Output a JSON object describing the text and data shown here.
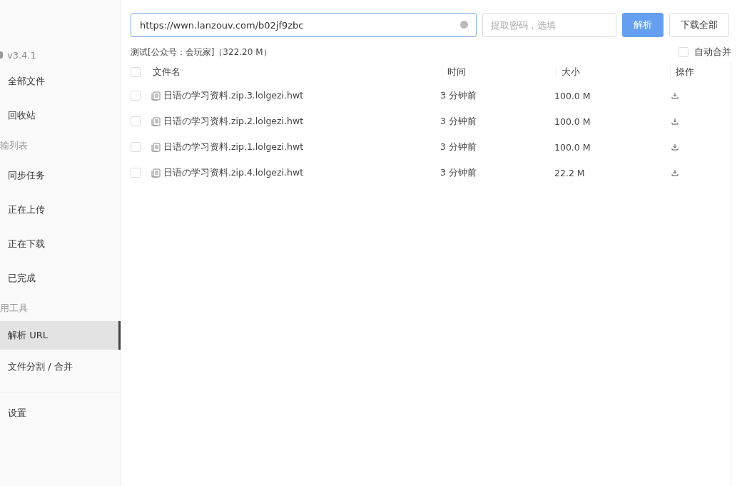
{
  "sidebar": {
    "version": "v3.4.1",
    "sections": [
      {
        "items": [
          {
            "label": "全部文件",
            "selected": false
          },
          {
            "label": "回收站",
            "selected": false
          }
        ]
      },
      {
        "title": "输列表",
        "items": [
          {
            "label": "同步任务",
            "selected": false
          },
          {
            "label": "正在上传",
            "selected": false
          },
          {
            "label": "正在下载",
            "selected": false
          },
          {
            "label": "已完成",
            "selected": false
          }
        ]
      },
      {
        "title": "用工具",
        "items": [
          {
            "label": "解析 URL",
            "selected": true
          },
          {
            "label": "文件分割 / 合并",
            "selected": false
          }
        ]
      },
      {
        "items": [
          {
            "label": "设置",
            "selected": false
          }
        ]
      }
    ]
  },
  "url_field": {
    "value": "https://wwn.lanzouv.com/b02jf9zbc"
  },
  "password_field": {
    "placeholder": "提取密码，选填"
  },
  "buttons": [
    {
      "label": "解析",
      "kind": "primary"
    },
    {
      "label": "下载全部",
      "kind": "default"
    }
  ],
  "summary": "测试[公众号：会玩家]（322.20 M）",
  "auto_merge": {
    "label": "自动合并",
    "checked": false
  },
  "table": {
    "select_all": {
      "checked": false
    },
    "columns": [
      "文件名",
      "时间",
      "大小",
      "操作"
    ],
    "rows": [
      {
        "name": "日语の学习资料.zip.3.lolgezi.hwt",
        "time": "3 分钟前",
        "size": "100.0 M",
        "checked": false
      },
      {
        "name": "日语の学习资料.zip.2.lolgezi.hwt",
        "time": "3 分钟前",
        "size": "100.0 M",
        "checked": false
      },
      {
        "name": "日语の学习资料.zip.1.lolgezi.hwt",
        "time": "3 分钟前",
        "size": "100.0 M",
        "checked": false
      },
      {
        "name": "日语の学习资料.zip.4.lolgezi.hwt",
        "time": "3 分钟前",
        "size": "22.2 M",
        "checked": false
      }
    ]
  }
}
